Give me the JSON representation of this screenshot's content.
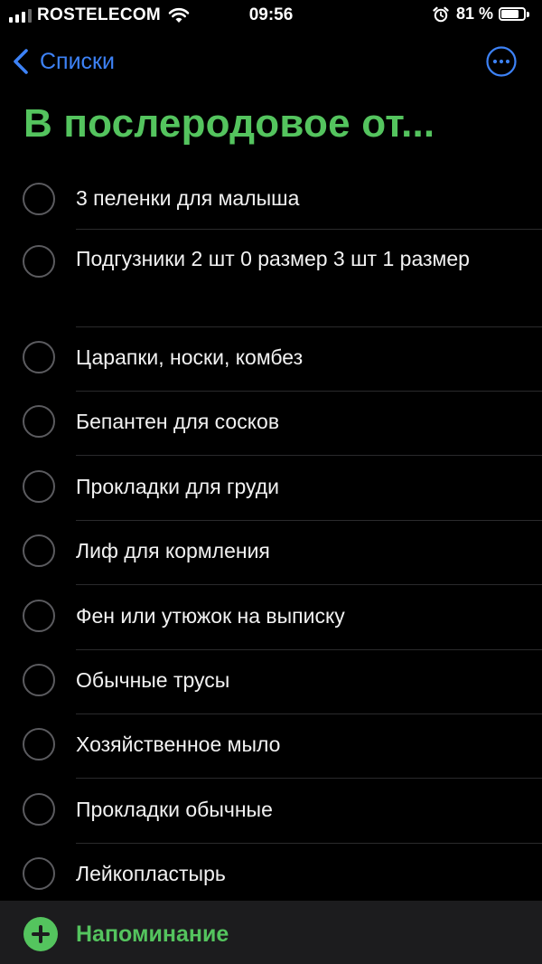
{
  "status_bar": {
    "carrier": "ROSTELECOM",
    "time": "09:56",
    "battery_percent": "81 %",
    "battery_level": 0.81,
    "signal_bars_active": 3,
    "signal_bars_total": 4
  },
  "nav": {
    "back_label": "Списки",
    "more_icon": "ellipsis-circle-icon",
    "accent_color": "#3d82f6"
  },
  "title": "В послеродовое от...",
  "title_color": "#54c45e",
  "reminders": [
    "3 пеленки для малыша",
    "Подгузники 2 шт 0 размер 3 шт 1 размер",
    "Царапки, носки, комбез",
    "Бепантен для сосков",
    "Прокладки для груди",
    "Лиф для кормления",
    "Фен или утюжок на выписку",
    "Обычные трусы",
    "Хозяйственное мыло",
    "Прокладки обычные",
    "Лейкопластырь"
  ],
  "toolbar": {
    "new_reminder_label": "Напоминание",
    "new_reminder_icon": "plus-circle-icon"
  }
}
